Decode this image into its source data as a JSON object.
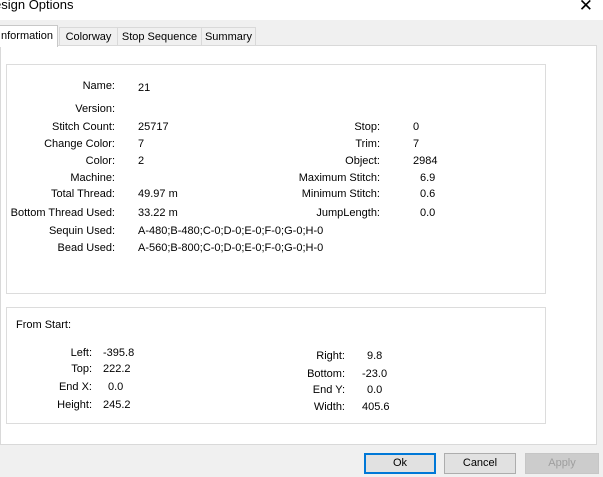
{
  "window": {
    "title": "esign Options",
    "close_glyph": "✕"
  },
  "tabs": [
    {
      "label": "nformation",
      "active": true
    },
    {
      "label": "Colorway",
      "active": false
    },
    {
      "label": "Stop Sequence",
      "active": false
    },
    {
      "label": "Summary",
      "active": false
    }
  ],
  "info": {
    "name": {
      "label": "Name:",
      "value": "21"
    },
    "version": {
      "label": "Version:",
      "value": ""
    },
    "stitch_count": {
      "label": "Stitch Count:",
      "value": "25717"
    },
    "change_color": {
      "label": "Change Color:",
      "value": "7"
    },
    "color": {
      "label": "Color:",
      "value": "2"
    },
    "machine": {
      "label": "Machine:",
      "value": ""
    },
    "total_thread": {
      "label": "Total Thread:",
      "value": "49.97 m"
    },
    "bottom_thread": {
      "label": "Bottom Thread Used:",
      "value": "33.22 m"
    },
    "sequin": {
      "label": "Sequin Used:",
      "value": "A-480;B-480;C-0;D-0;E-0;F-0;G-0;H-0"
    },
    "bead": {
      "label": "Bead Used:",
      "value": "A-560;B-800;C-0;D-0;E-0;F-0;G-0;H-0"
    },
    "stop": {
      "label": "Stop:",
      "value": "0"
    },
    "trim": {
      "label": "Trim:",
      "value": "7"
    },
    "object": {
      "label": "Object:",
      "value": "2984"
    },
    "max_stitch": {
      "label": "Maximum Stitch:",
      "value": "6.9"
    },
    "min_stitch": {
      "label": "Minimum Stitch:",
      "value": "0.6"
    },
    "jump_length": {
      "label": "JumpLength:",
      "value": "0.0"
    }
  },
  "from_start": {
    "heading": "From Start:",
    "left": {
      "label": "Left:",
      "value": "-395.8"
    },
    "top": {
      "label": "Top:",
      "value": "222.2"
    },
    "end_x": {
      "label": "End X:",
      "value": "0.0"
    },
    "height": {
      "label": "Height:",
      "value": "245.2"
    },
    "right": {
      "label": "Right:",
      "value": "9.8"
    },
    "bottom": {
      "label": "Bottom:",
      "value": "-23.0"
    },
    "end_y": {
      "label": "End Y:",
      "value": "0.0"
    },
    "width": {
      "label": "Width:",
      "value": "405.6"
    }
  },
  "buttons": {
    "ok": "Ok",
    "cancel": "Cancel",
    "apply": "Apply"
  }
}
